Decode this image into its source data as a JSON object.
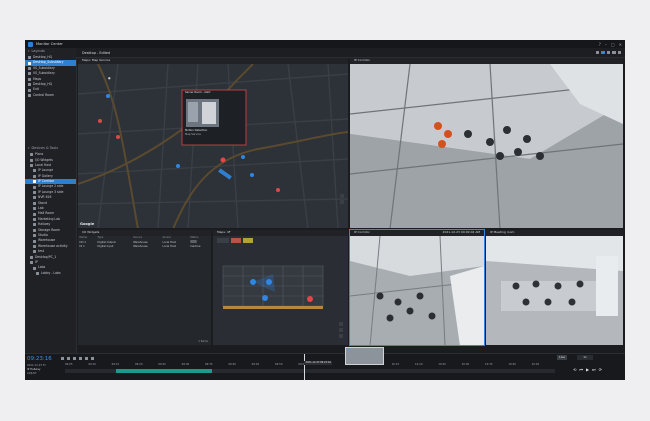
{
  "app": {
    "title": "Monitor Center"
  },
  "window_controls": [
    "?",
    "–",
    "□",
    "✕"
  ],
  "sidebar": {
    "layouts_title": "Layouts",
    "layouts": [
      {
        "label": "Desktop_HQ",
        "selected": false
      },
      {
        "label": "Desktop_Subsidiary",
        "selected": true
      },
      {
        "label": "VS_Subsidiary",
        "selected": false
      },
      {
        "label": "VS_Subsidiary",
        "selected": false
      },
      {
        "label": "Maps",
        "selected": false
      },
      {
        "label": "Desktop_HQ",
        "selected": false
      },
      {
        "label": "Exit",
        "selected": false
      },
      {
        "label": "Control Room",
        "selected": false
      }
    ],
    "devices_title": "Devices & Tools",
    "devices": [
      {
        "label": "Plans",
        "indent": 1,
        "selected": false
      },
      {
        "label": "I/O Widgets",
        "indent": 1,
        "selected": false
      },
      {
        "label": "Local Host",
        "indent": 1,
        "selected": false
      },
      {
        "label": "IP Lounge",
        "indent": 2,
        "selected": false
      },
      {
        "label": "IP Gallery",
        "indent": 2,
        "selected": false
      },
      {
        "label": "IP Corridor",
        "indent": 2,
        "selected": true
      },
      {
        "label": "IP Lounge 2 side",
        "indent": 2,
        "selected": false
      },
      {
        "label": "IP Lounge 3 side",
        "indent": 2,
        "selected": false
      },
      {
        "label": "NVR 616",
        "indent": 2,
        "selected": false
      },
      {
        "label": "Stand",
        "indent": 2,
        "selected": false
      },
      {
        "label": "Lab",
        "indent": 2,
        "selected": false
      },
      {
        "label": "Mail Room",
        "indent": 2,
        "selected": false
      },
      {
        "label": "Marketing Lab",
        "indent": 2,
        "selected": false
      },
      {
        "label": "Hallway",
        "indent": 2,
        "selected": false
      },
      {
        "label": "Storage Room",
        "indent": 2,
        "selected": false
      },
      {
        "label": "Studio",
        "indent": 2,
        "selected": false
      },
      {
        "label": "Warehouse",
        "indent": 2,
        "selected": false
      },
      {
        "label": "Warehouse activity",
        "indent": 2,
        "selected": false
      },
      {
        "label": "test",
        "indent": 2,
        "selected": false
      },
      {
        "label": "Desktop/PC_1",
        "indent": 1,
        "selected": false
      },
      {
        "label": "IP",
        "indent": 1,
        "selected": false
      },
      {
        "label": "Labs",
        "indent": 2,
        "selected": false
      },
      {
        "label": "Lobby - Labs",
        "indent": 3,
        "selected": false
      }
    ]
  },
  "toolbar": {
    "title": "Desktop - Edited"
  },
  "map_pane": {
    "title": "Maps: Map Service",
    "google": "Google",
    "popup": {
      "title": "Server Room - Alert",
      "event": "Motion Detection",
      "source": "Map Service"
    }
  },
  "cam_top": {
    "title": "IP Corridor"
  },
  "io_pane": {
    "title": "I/O Widgets",
    "columns": [
      "Name",
      "Type",
      "Source",
      "Server",
      "Status"
    ],
    "rows": [
      [
        "DO 1",
        "Digital Output",
        "Warehouse",
        "Local Host",
        ""
      ],
      [
        "DI 1",
        "Digital Input",
        "Warehouse",
        "Local Host",
        "Inactive"
      ]
    ],
    "footer": "1 Items"
  },
  "floor_pane": {
    "title": "Maps: 4F"
  },
  "cam_corridor": {
    "title": "IP Corridor",
    "timestamp": "2021-12-23 09:09:02 AM"
  },
  "cam_meeting": {
    "title": "IP Meeting room"
  },
  "bottom": {
    "time": "09:23:16",
    "date": "2021-12-23 Fri",
    "camera": "IP Hallway",
    "status": "ADJUST",
    "live": "Live",
    "speed": "1x",
    "ticks": [
      "09:05",
      "09:10",
      "09:15",
      "09:20",
      "09:25",
      "09:30",
      "09:35",
      "09:40",
      "09:45",
      "09:50",
      "09:55",
      "10:00",
      "10:05",
      "10:10",
      "10:15",
      "10:20",
      "10:25",
      "10:30",
      "10:35",
      "10:40",
      "10:45"
    ],
    "cursor_label": "2021-12-23 09:23:16"
  }
}
